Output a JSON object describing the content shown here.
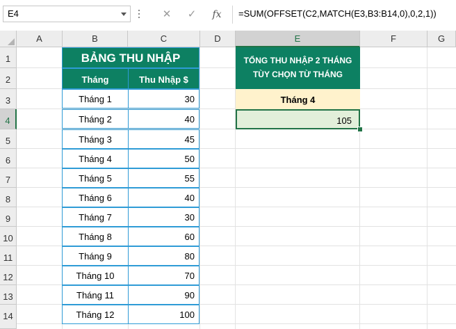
{
  "formula_bar": {
    "name_box": "E4",
    "cancel_icon": "✕",
    "enter_icon": "✓",
    "fx_label": "fx",
    "formula": "=SUM(OFFSET(C2,MATCH(E3,B3:B14,0),0,2,1))"
  },
  "columns": [
    "A",
    "B",
    "C",
    "D",
    "E",
    "F",
    "G"
  ],
  "rows": [
    "1",
    "2",
    "3",
    "4",
    "5",
    "6",
    "7",
    "8",
    "9",
    "10",
    "11",
    "12",
    "13",
    "14"
  ],
  "table": {
    "title": "BẢNG THU NHẬP",
    "header_month": "Tháng",
    "header_income": "Thu Nhập $",
    "data": [
      {
        "month": "Tháng 1",
        "income": "30"
      },
      {
        "month": "Tháng 2",
        "income": "40"
      },
      {
        "month": "Tháng 3",
        "income": "45"
      },
      {
        "month": "Tháng 4",
        "income": "50"
      },
      {
        "month": "Tháng 5",
        "income": "55"
      },
      {
        "month": "Tháng 6",
        "income": "40"
      },
      {
        "month": "Tháng 7",
        "income": "30"
      },
      {
        "month": "Tháng 8",
        "income": "60"
      },
      {
        "month": "Tháng 9",
        "income": "80"
      },
      {
        "month": "Tháng 10",
        "income": "70"
      },
      {
        "month": "Tháng 11",
        "income": "90"
      },
      {
        "month": "Tháng 12",
        "income": "100"
      }
    ]
  },
  "summary": {
    "title_line1": "TỔNG THU NHẬP 2 THÁNG",
    "title_line2": "TÙY CHỌN TỪ THÁNG",
    "selected_month": "Tháng 4",
    "result": "105"
  },
  "colors": {
    "header_green": "#0d8062",
    "table_border_blue": "#2e9bd6",
    "month_yellow": "#fff2cc",
    "result_green": "#e2efda",
    "selection_green": "#217346"
  }
}
